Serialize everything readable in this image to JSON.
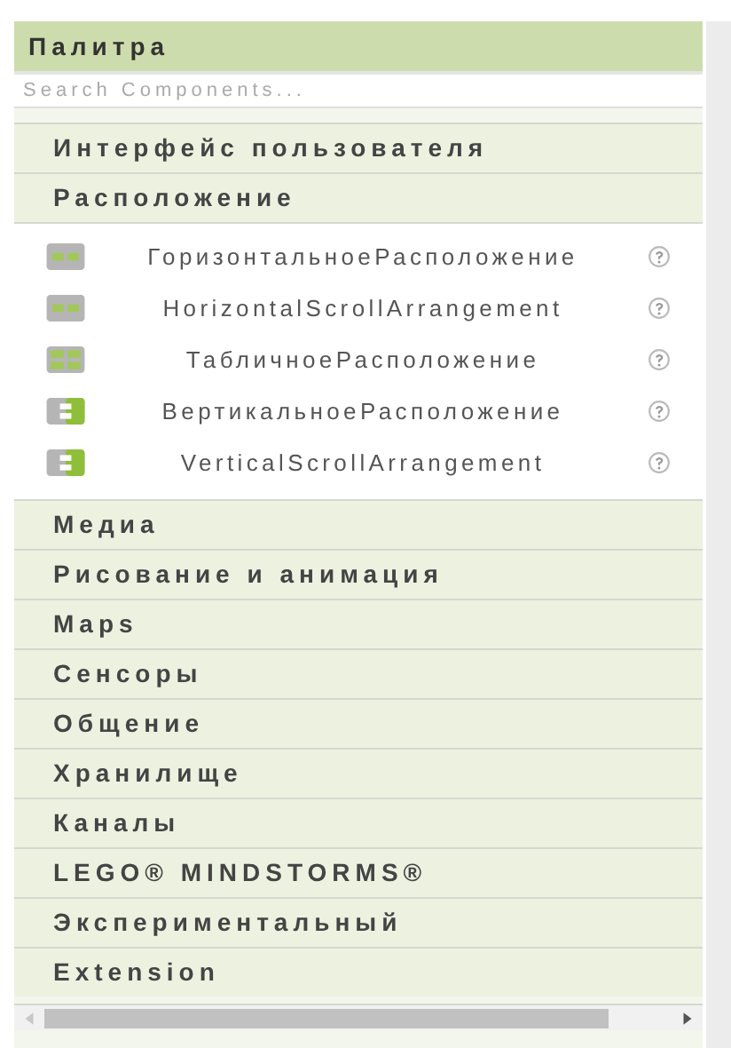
{
  "palette": {
    "title": "Палитра",
    "search": {
      "placeholder": "Search Components..."
    },
    "categories": [
      {
        "label": "Интерфейс пользователя"
      },
      {
        "label": "Расположение",
        "items": [
          {
            "label": "ГоризонтальноеРасположение",
            "kind": "horizontal"
          },
          {
            "label": "HorizontalScrollArrangement",
            "kind": "horizontal"
          },
          {
            "label": "ТабличноеРасположение",
            "kind": "table"
          },
          {
            "label": "ВертикальноеРасположение",
            "kind": "vertical"
          },
          {
            "label": "VerticalScrollArrangement",
            "kind": "vertical"
          }
        ]
      },
      {
        "label": "Медиа"
      },
      {
        "label": "Рисование и анимация"
      },
      {
        "label": "Maps"
      },
      {
        "label": "Сенсоры"
      },
      {
        "label": "Общение"
      },
      {
        "label": "Хранилище"
      },
      {
        "label": "Каналы"
      },
      {
        "label": "LEGO® MINDSTORMS®"
      },
      {
        "label": "Экспериментальный"
      },
      {
        "label": "Extension"
      }
    ]
  }
}
